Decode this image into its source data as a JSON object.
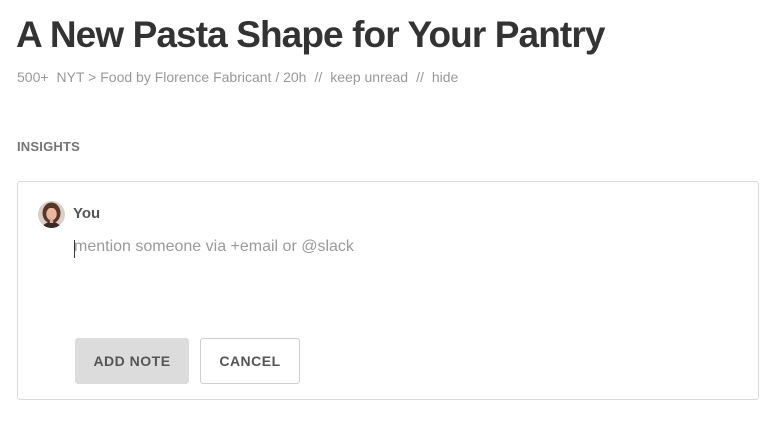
{
  "article": {
    "title": "A New Pasta Shape for Your Pantry",
    "meta": {
      "count": "500+",
      "source": "NYT > Food by Florence Fabricant / 20h",
      "separator": "//",
      "keep_unread": "keep unread",
      "hide": "hide"
    }
  },
  "insights": {
    "section_label": "INSIGHTS",
    "note": {
      "user_name": "You",
      "avatar_icon": "user-avatar-photo",
      "input_value": "",
      "input_placeholder": "mention someone via +email or @slack",
      "add_note_label": "ADD NOTE",
      "cancel_label": "CANCEL"
    }
  },
  "colors": {
    "title": "#333333",
    "meta": "#999999",
    "add_button_bg": "#dcdcdc",
    "card_border": "#dadada"
  }
}
